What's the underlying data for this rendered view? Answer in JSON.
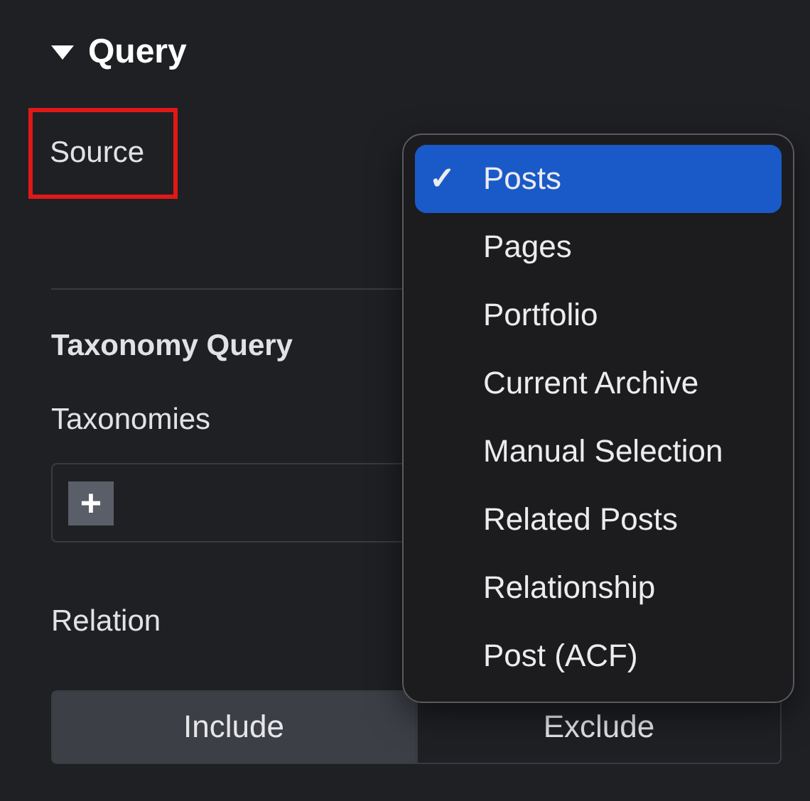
{
  "section": {
    "title": "Query",
    "expanded": true
  },
  "source": {
    "label": "Source",
    "highlighted": true
  },
  "taxonomy_heading": "Taxonomy Query",
  "taxonomies": {
    "label": "Taxonomies",
    "add_button": "+"
  },
  "relation": {
    "label": "Relation",
    "options": [
      {
        "label": "Include",
        "selected": true
      },
      {
        "label": "Exclude",
        "selected": false
      }
    ]
  },
  "dropdown": {
    "check": "✓",
    "options": [
      {
        "label": "Posts",
        "selected": true
      },
      {
        "label": "Pages",
        "selected": false
      },
      {
        "label": "Portfolio",
        "selected": false
      },
      {
        "label": "Current Archive",
        "selected": false
      },
      {
        "label": "Manual Selection",
        "selected": false
      },
      {
        "label": "Related Posts",
        "selected": false
      },
      {
        "label": "Relationship",
        "selected": false
      },
      {
        "label": "Post (ACF)",
        "selected": false
      }
    ]
  }
}
